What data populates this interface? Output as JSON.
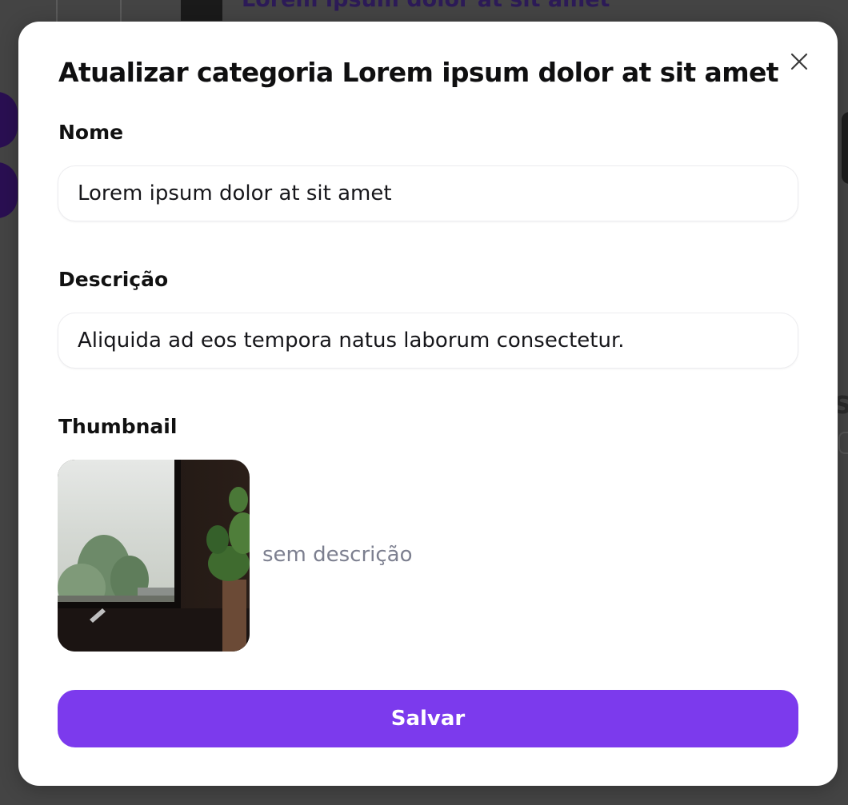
{
  "background": {
    "title": "Lorem ipsum dolor at sit amet"
  },
  "modal": {
    "title": "Atualizar categoria Lorem ipsum dolor at sit amet",
    "close_icon": "close-icon",
    "fields": {
      "name": {
        "label": "Nome",
        "value": "Lorem ipsum dolor at sit amet"
      },
      "description": {
        "label": "Descrição",
        "value": "Aliquida ad eos tempora natus laborum consectetur."
      },
      "thumbnail": {
        "label": "Thumbnail",
        "caption": "sem descrição"
      }
    },
    "save_label": "Salvar"
  },
  "colors": {
    "accent": "#7c3aed",
    "overlay": "#444444",
    "caption": "#7c7f8f"
  }
}
